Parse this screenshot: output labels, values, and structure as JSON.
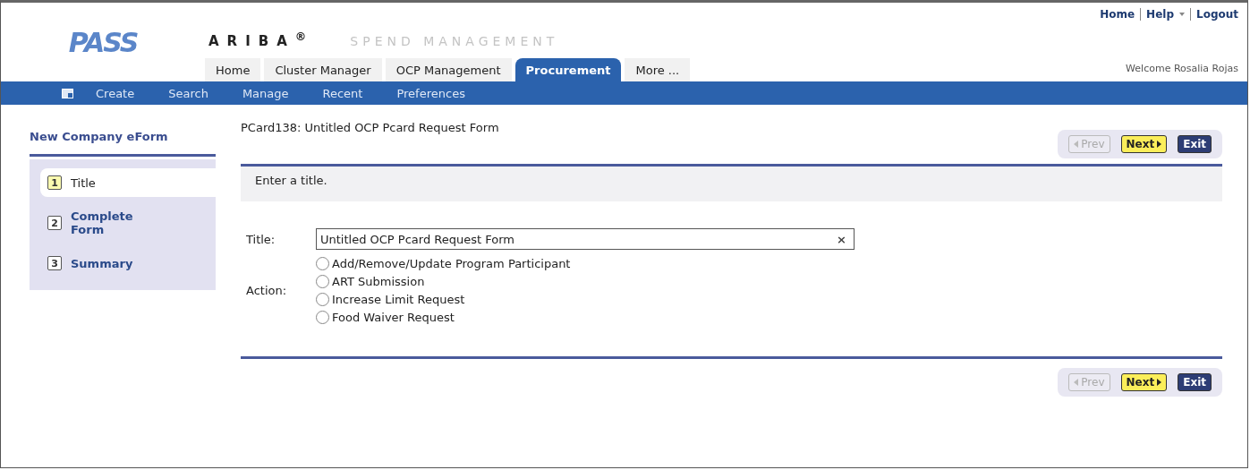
{
  "logo": "PASS",
  "brand": {
    "name": "ARIBA$^{®}$",
    "tagline": "SPEND MANAGEMENT"
  },
  "top_links": [
    "Home",
    "Help",
    "Logout"
  ],
  "welcome": "Welcome Rosalia Rojas",
  "tabs": [
    {
      "label": "Home",
      "selected": false
    },
    {
      "label": "Cluster Manager",
      "selected": false
    },
    {
      "label": "OCP Management",
      "selected": false
    },
    {
      "label": "Procurement",
      "selected": true
    },
    {
      "label": "More ...",
      "selected": false
    }
  ],
  "subnav": [
    "Create",
    "Search",
    "Manage",
    "Recent",
    "Preferences"
  ],
  "sidebar": {
    "title": "New Company eForm",
    "steps": [
      {
        "number": "1",
        "label": "Title",
        "selected": true
      },
      {
        "number": "2",
        "label": "Complete Form",
        "selected": false
      },
      {
        "number": "3",
        "label": "Summary",
        "selected": false
      }
    ]
  },
  "form": {
    "heading": "PCard138: Untitled OCP Pcard Request Form",
    "instruction": "Enter a title.",
    "title_label": "Title:",
    "title_value": "Untitled OCP Pcard Request Form",
    "clear": "×",
    "action_label": "Action:",
    "actions": [
      {
        "label": "Add/Remove/Update Program Participant",
        "selected": false
      },
      {
        "label": "ART Submission",
        "selected": false
      },
      {
        "label": "Increase Limit Request",
        "selected": false
      },
      {
        "label": "Food Waiver Request",
        "selected": false
      }
    ]
  },
  "top_buttons": [
    {
      "kind": "prev",
      "label": "Prev",
      "disabled": true
    },
    {
      "kind": "next",
      "label": "Next",
      "disabled": false
    },
    {
      "kind": "exit",
      "label": "Exit",
      "disabled": false
    }
  ],
  "bottom_buttons": [
    {
      "kind": "prev",
      "label": "Prev",
      "disabled": true
    },
    {
      "kind": "next",
      "label": "Next",
      "disabled": false
    },
    {
      "kind": "exit",
      "label": "Exit",
      "disabled": false
    }
  ]
}
